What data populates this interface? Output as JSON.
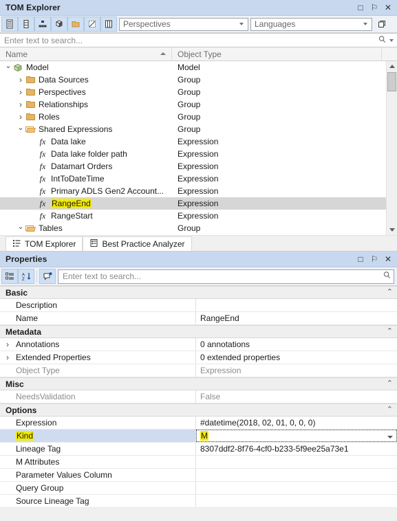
{
  "tom_explorer": {
    "title": "TOM Explorer",
    "window_buttons": [
      {
        "name": "maximize",
        "glyph": "□"
      },
      {
        "name": "auto-hide-pin",
        "glyph": "⚐"
      },
      {
        "name": "close",
        "glyph": "✕"
      }
    ],
    "toolbar": {
      "icons": [
        {
          "name": "tables-icon",
          "active": true
        },
        {
          "name": "columns-icon",
          "active": true
        },
        {
          "name": "hierarchies-icon",
          "active": true
        },
        {
          "name": "measures-cube-icon",
          "active": true
        },
        {
          "name": "folders-icon",
          "active": true
        },
        {
          "name": "hidden-objects-icon",
          "active": true
        },
        {
          "name": "display-folders-icon",
          "active": true
        }
      ],
      "perspectives": {
        "label": "Perspectives"
      },
      "languages": {
        "label": "Languages"
      },
      "expand_button": "expand-all-icon"
    },
    "search": {
      "placeholder": "Enter text to search..."
    },
    "columns": [
      {
        "key": "name",
        "label": "Name",
        "sorted": "asc"
      },
      {
        "key": "type",
        "label": "Object Type"
      }
    ],
    "rows": [
      {
        "name": "Model",
        "type": "Model",
        "depth": 0,
        "expander": "expanded",
        "icon": "model-icon"
      },
      {
        "name": "Data Sources",
        "type": "Group",
        "depth": 1,
        "expander": "collapsed",
        "icon": "folder-closed-icon"
      },
      {
        "name": "Perspectives",
        "type": "Group",
        "depth": 1,
        "expander": "collapsed",
        "icon": "folder-closed-icon"
      },
      {
        "name": "Relationships",
        "type": "Group",
        "depth": 1,
        "expander": "collapsed",
        "icon": "folder-closed-icon"
      },
      {
        "name": "Roles",
        "type": "Group",
        "depth": 1,
        "expander": "collapsed",
        "icon": "folder-closed-icon"
      },
      {
        "name": "Shared Expressions",
        "type": "Group",
        "depth": 1,
        "expander": "expanded",
        "icon": "folder-open-icon"
      },
      {
        "name": "Data lake",
        "type": "Expression",
        "depth": 2,
        "expander": "none",
        "icon": "fx-icon"
      },
      {
        "name": "Data lake folder path",
        "type": "Expression",
        "depth": 2,
        "expander": "none",
        "icon": "fx-icon"
      },
      {
        "name": "Datamart Orders",
        "type": "Expression",
        "depth": 2,
        "expander": "none",
        "icon": "fx-icon"
      },
      {
        "name": "IntToDateTime",
        "type": "Expression",
        "depth": 2,
        "expander": "none",
        "icon": "fx-icon"
      },
      {
        "name": "Primary ADLS Gen2 Account...",
        "type": "Expression",
        "depth": 2,
        "expander": "none",
        "icon": "fx-icon"
      },
      {
        "name": "RangeEnd",
        "type": "Expression",
        "depth": 2,
        "expander": "none",
        "icon": "fx-icon",
        "selected": true,
        "highlighted": true
      },
      {
        "name": "RangeStart",
        "type": "Expression",
        "depth": 2,
        "expander": "none",
        "icon": "fx-icon"
      },
      {
        "name": "Tables",
        "type": "Group",
        "depth": 1,
        "expander": "expanded",
        "icon": "folder-open-icon"
      }
    ],
    "tabs": [
      {
        "label": "TOM Explorer",
        "icon": "tree-list-icon",
        "active": true
      },
      {
        "label": "Best Practice Analyzer",
        "icon": "analyzer-icon",
        "active": false
      }
    ]
  },
  "properties": {
    "title": "Properties",
    "window_buttons": [
      {
        "name": "maximize",
        "glyph": "□"
      },
      {
        "name": "auto-hide-pin",
        "glyph": "⚐"
      },
      {
        "name": "close",
        "glyph": "✕"
      }
    ],
    "toolbar": {
      "icons": [
        {
          "name": "categorized-view-icon",
          "active": true
        },
        {
          "name": "alphabetical-sort-icon",
          "active": true
        },
        {
          "name": "property-pages-icon",
          "active": true
        }
      ]
    },
    "search": {
      "placeholder": "Enter text to search..."
    },
    "categories": [
      {
        "name": "Basic",
        "collapsed": false,
        "rows": [
          {
            "label": "Description",
            "value": "",
            "expander": "none"
          },
          {
            "label": "Name",
            "value": "RangeEnd",
            "expander": "none"
          }
        ]
      },
      {
        "name": "Metadata",
        "collapsed": false,
        "rows": [
          {
            "label": "Annotations",
            "value": "0 annotations",
            "expander": "collapsed"
          },
          {
            "label": "Extended Properties",
            "value": "0 extended properties",
            "expander": "collapsed"
          },
          {
            "label": "Object Type",
            "value": "Expression",
            "expander": "none",
            "readonly": true
          }
        ]
      },
      {
        "name": "Misc",
        "collapsed": false,
        "rows": [
          {
            "label": "NeedsValidation",
            "value": "False",
            "expander": "none",
            "readonly": true
          }
        ]
      },
      {
        "name": "Options",
        "collapsed": false,
        "rows": [
          {
            "label": "Expression",
            "value": "#datetime(2018, 02, 01, 0, 0, 0)",
            "expander": "none"
          },
          {
            "label": "Kind",
            "value": "M",
            "expander": "none",
            "selected": true,
            "highlighted": true,
            "dropdown": true
          },
          {
            "label": "Lineage Tag",
            "value": "8307ddf2-8f76-4cf0-b233-5f9ee25a73e1",
            "expander": "none"
          },
          {
            "label": "M Attributes",
            "value": "",
            "expander": "none"
          },
          {
            "label": "Parameter Values Column",
            "value": "",
            "expander": "none"
          },
          {
            "label": "Query Group",
            "value": "",
            "expander": "none"
          },
          {
            "label": "Source Lineage Tag",
            "value": "",
            "expander": "none"
          }
        ]
      }
    ]
  },
  "colors": {
    "title_bar": "#c8d8ee",
    "highlight": "#f2ea00",
    "selected_row": "#d6d6d6",
    "selected_prop_row": "#cfdcf0"
  }
}
